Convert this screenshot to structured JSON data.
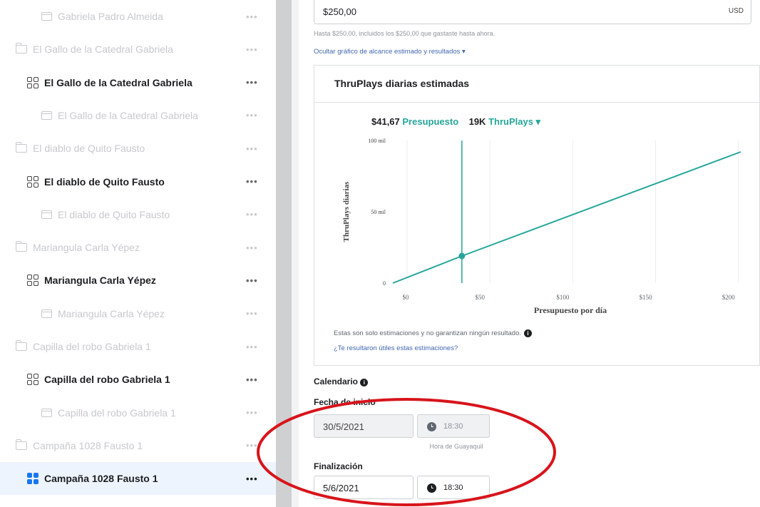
{
  "sidebar": {
    "rows": [
      {
        "label": "Gabriela Padro Almeida",
        "kind": "ad",
        "state": "dim"
      },
      {
        "label": "El Gallo de la Catedral Gabriela",
        "kind": "folder",
        "state": "dim"
      },
      {
        "label": "El Gallo de la Catedral Gabriela",
        "kind": "adset",
        "state": "bold"
      },
      {
        "label": "El Gallo de la Catedral Gabriela",
        "kind": "ad",
        "state": "dim"
      },
      {
        "label": "El diablo de Quito Fausto",
        "kind": "folder",
        "state": "dim"
      },
      {
        "label": "El diablo de Quito Fausto",
        "kind": "adset",
        "state": "bold"
      },
      {
        "label": "El diablo de Quito Fausto",
        "kind": "ad",
        "state": "dim"
      },
      {
        "label": "Mariangula Carla Yépez",
        "kind": "folder",
        "state": "dim"
      },
      {
        "label": "Mariangula Carla Yépez",
        "kind": "adset",
        "state": "bold"
      },
      {
        "label": "Mariangula Carla Yépez",
        "kind": "ad",
        "state": "dim"
      },
      {
        "label": "Capilla del robo Gabriela 1",
        "kind": "folder",
        "state": "dim"
      },
      {
        "label": "Capilla del robo Gabriela 1",
        "kind": "adset",
        "state": "bold"
      },
      {
        "label": "Capilla del robo Gabriela 1",
        "kind": "ad",
        "state": "dim"
      },
      {
        "label": "Campaña 1028 Fausto 1",
        "kind": "folder",
        "state": "dim"
      },
      {
        "label": "Campaña 1028 Fausto 1",
        "kind": "campaign",
        "state": "selected"
      }
    ],
    "more_label": "•••"
  },
  "budget": {
    "value": "$250,00",
    "currency": "USD",
    "note": "Hasta $250,00, incluidos los $250,00 que gastaste hasta ahora.",
    "toggle_link": "Ocultar gráfico de alcance estimado y resultados ▾"
  },
  "estimate_card": {
    "title": "ThruPlays diarias estimadas",
    "budget_amount": "$41,67",
    "budget_label": "Presupuesto",
    "result_amount": "19K",
    "result_label": "ThruPlays ▾",
    "disclaimer": "Estas son solo estimaciones y no garantizan ningún resultado.",
    "info_icon": "i",
    "feedback_link": "¿Te resultaron útiles estas estimaciones?"
  },
  "chart_data": {
    "type": "line",
    "xlabel": "Presupuesto por día",
    "ylabel": "ThruPlays diarias",
    "x_ticks": [
      "$0",
      "$50",
      "$100",
      "$150",
      "$200"
    ],
    "x_tick_values": [
      0,
      50,
      100,
      150,
      200
    ],
    "y_ticks": [
      "0",
      "50 mil",
      "100 mil"
    ],
    "y_tick_values": [
      0,
      50000,
      100000
    ],
    "xlim": [
      0,
      210
    ],
    "ylim": [
      0,
      100000
    ],
    "series": [
      {
        "x": [
          0,
          41.67,
          210
        ],
        "y": [
          0,
          19000,
          92000
        ]
      }
    ],
    "marker": {
      "x": 41.67,
      "y": 19000
    },
    "vertical_line_x": 41.67,
    "color": "#26a69a",
    "grid": true
  },
  "schedule": {
    "heading": "Calendario",
    "start_label": "Fecha de inicio",
    "start_date": "30/5/2021",
    "start_time": "18:30",
    "timezone_note": "Hora de Guayaquil",
    "end_label": "Finalización",
    "end_date": "5/6/2021",
    "end_time": "18:30"
  },
  "annotation": {
    "shape": "ellipse",
    "color": "#d8141b"
  }
}
